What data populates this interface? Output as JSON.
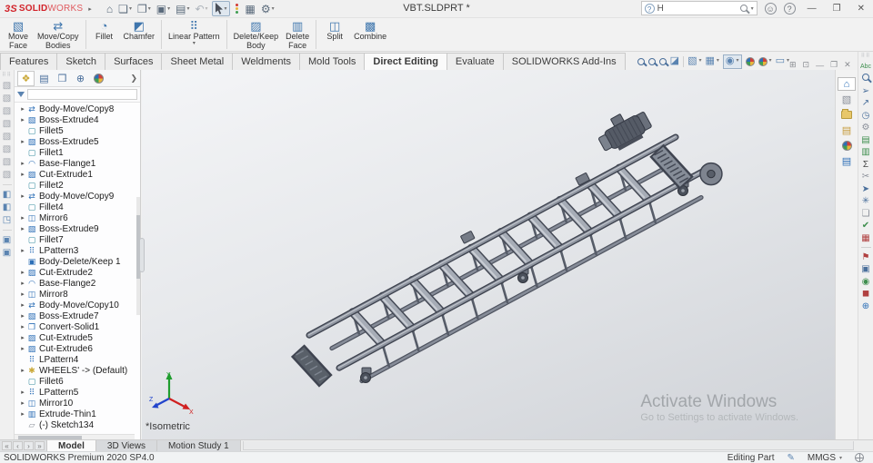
{
  "window": {
    "brand_prefix": "3S",
    "brand": "SOLID",
    "brand_suffix": "WORKS",
    "title": "VBT.SLDPRT *",
    "search_value": "H",
    "controls": {
      "minimize": "—",
      "restore": "❐",
      "close": "✕"
    }
  },
  "quick_access": [
    {
      "name": "home-button",
      "glyph": "⌂",
      "dropdown": false
    },
    {
      "name": "new-document-button",
      "glyph": "❏",
      "dropdown": true
    },
    {
      "name": "open-button",
      "glyph": "❐",
      "dropdown": true
    },
    {
      "name": "save-button",
      "glyph": "▣",
      "dropdown": true
    },
    {
      "name": "print-button",
      "glyph": "▤",
      "dropdown": true
    },
    {
      "name": "undo-button",
      "glyph": "↶",
      "dropdown": true,
      "disabled": true
    },
    {
      "name": "select-button",
      "glyph": "cursor",
      "dropdown": true,
      "selected": true
    },
    {
      "name": "rebuild-button",
      "glyph": "traffic",
      "dropdown": false
    },
    {
      "name": "file-properties-button",
      "glyph": "▦",
      "dropdown": false
    },
    {
      "name": "options-button",
      "glyph": "⚙",
      "dropdown": true
    }
  ],
  "ribbon": {
    "groups": [
      {
        "buttons": [
          {
            "label": "Move\nFace",
            "icon": "▧",
            "name": "move-face-button"
          },
          {
            "label": "Move/Copy\nBodies",
            "icon": "⇄",
            "name": "move-copy-bodies-button"
          }
        ]
      },
      {
        "buttons": [
          {
            "label": "Fillet",
            "icon": "◔",
            "name": "fillet-button"
          },
          {
            "label": "Chamfer",
            "icon": "◩",
            "name": "chamfer-button"
          }
        ]
      },
      {
        "buttons": [
          {
            "label": "Linear Pattern",
            "icon": "⠿",
            "name": "linear-pattern-button",
            "dropdown": true
          }
        ]
      },
      {
        "buttons": [
          {
            "label": "Delete/Keep\nBody",
            "icon": "▨",
            "name": "delete-keep-body-button"
          },
          {
            "label": "Delete\nFace",
            "icon": "▥",
            "name": "delete-face-button"
          }
        ]
      },
      {
        "buttons": [
          {
            "label": "Split",
            "icon": "◫",
            "name": "split-button"
          },
          {
            "label": "Combine",
            "icon": "▩",
            "name": "combine-button"
          }
        ]
      }
    ]
  },
  "command_tabs": {
    "items": [
      "Features",
      "Sketch",
      "Surfaces",
      "Sheet Metal",
      "Weldments",
      "Mold Tools",
      "Direct Editing",
      "Evaluate",
      "SOLIDWORKS Add-Ins"
    ],
    "active": "Direct Editing"
  },
  "headsup_toolbar": [
    {
      "name": "zoom-to-fit-icon",
      "type": "mag"
    },
    {
      "name": "zoom-to-area-icon",
      "type": "mag"
    },
    {
      "name": "previous-view-icon",
      "type": "mag"
    },
    {
      "name": "section-view-icon",
      "glyph": "◪"
    },
    {
      "name": "sep"
    },
    {
      "name": "view-orientation-icon",
      "glyph": "▧",
      "dropdown": true
    },
    {
      "name": "display-style-icon",
      "glyph": "▦",
      "dropdown": true
    },
    {
      "name": "hide-show-items-icon",
      "glyph": "◉",
      "dropdown": true,
      "boxed": true
    },
    {
      "name": "edit-appearance-icon",
      "type": "pie"
    },
    {
      "name": "apply-scene-icon",
      "type": "pie",
      "dropdown": true
    },
    {
      "name": "view-settings-icon",
      "glyph": "▭",
      "dropdown": true
    }
  ],
  "doc_window_controls": [
    "⊞",
    "⊡",
    "—",
    "❐",
    "✕"
  ],
  "left_strip_icons": [
    "▧",
    "▧",
    "▧",
    "▧",
    "▧",
    "▧",
    "▧",
    "▧",
    "|",
    "◧",
    "◧",
    "◳",
    "|",
    "▣",
    "▣"
  ],
  "feature_panel": {
    "tabs": [
      {
        "name": "featuremanager-tab",
        "glyph": "❖",
        "color": "#caa93a",
        "active": true
      },
      {
        "name": "propertymanager-tab",
        "glyph": "▤",
        "color": "#4a6f9b"
      },
      {
        "name": "configurationmanager-tab",
        "glyph": "❒",
        "color": "#4a6f9b"
      },
      {
        "name": "dimxpertmanager-tab",
        "glyph": "⊕",
        "color": "#4a6f9b"
      },
      {
        "name": "displaymanager-tab",
        "type": "pie"
      }
    ],
    "expand_arrow": "❯",
    "tree_items": [
      {
        "label": "Body-Move/Copy8",
        "icon": "move",
        "arrow": true
      },
      {
        "label": "Boss-Extrude4",
        "icon": "extrude",
        "arrow": true
      },
      {
        "label": "Fillet5",
        "icon": "fillet",
        "arrow": false
      },
      {
        "label": "Boss-Extrude5",
        "icon": "extrude",
        "arrow": true
      },
      {
        "label": "Fillet1",
        "icon": "fillet",
        "arrow": false
      },
      {
        "label": "Base-Flange1",
        "icon": "flange",
        "arrow": true
      },
      {
        "label": "Cut-Extrude1",
        "icon": "cut",
        "arrow": true
      },
      {
        "label": "Fillet2",
        "icon": "fillet",
        "arrow": false
      },
      {
        "label": "Body-Move/Copy9",
        "icon": "move",
        "arrow": true
      },
      {
        "label": "Fillet4",
        "icon": "fillet",
        "arrow": false
      },
      {
        "label": "Mirror6",
        "icon": "mirror",
        "arrow": true
      },
      {
        "label": "Boss-Extrude9",
        "icon": "extrude",
        "arrow": true
      },
      {
        "label": "Fillet7",
        "icon": "fillet",
        "arrow": false
      },
      {
        "label": "LPattern3",
        "icon": "pattern",
        "arrow": true
      },
      {
        "label": "Body-Delete/Keep 1",
        "icon": "deletekeep",
        "arrow": false
      },
      {
        "label": "Cut-Extrude2",
        "icon": "cut",
        "arrow": true
      },
      {
        "label": "Base-Flange2",
        "icon": "flange",
        "arrow": true
      },
      {
        "label": "Mirror8",
        "icon": "mirror",
        "arrow": true
      },
      {
        "label": "Body-Move/Copy10",
        "icon": "move",
        "arrow": true
      },
      {
        "label": "Boss-Extrude7",
        "icon": "extrude",
        "arrow": true
      },
      {
        "label": "Convert-Solid1",
        "icon": "convert",
        "arrow": true
      },
      {
        "label": "Cut-Extrude5",
        "icon": "cut",
        "arrow": true
      },
      {
        "label": "Cut-Extrude6",
        "icon": "cut",
        "arrow": true
      },
      {
        "label": "LPattern4",
        "icon": "pattern",
        "arrow": false
      },
      {
        "label": "WHEELS' -> (Default)",
        "icon": "wheels",
        "arrow": true
      },
      {
        "label": "Fillet6",
        "icon": "fillet",
        "arrow": false
      },
      {
        "label": "LPattern5",
        "icon": "pattern",
        "arrow": true
      },
      {
        "label": "Mirror10",
        "icon": "mirror",
        "arrow": true
      },
      {
        "label": "Extrude-Thin1",
        "icon": "thin",
        "arrow": true
      },
      {
        "label": "(-) Sketch134",
        "icon": "sketch",
        "arrow": false
      }
    ]
  },
  "viewport": {
    "view_label": "*Isometric",
    "watermark_line1": "Activate Windows",
    "watermark_line2": "Go to Settings to activate Windows.",
    "triad": {
      "x": "X",
      "y": "Y",
      "z": "Z"
    },
    "model_name": "conveyor-frame"
  },
  "task_pane_tabs": [
    {
      "name": "home-tab",
      "glyph": "⌂",
      "color": "#2d6fb7",
      "active": true
    },
    {
      "name": "solidworks-resources-tab",
      "glyph": "▧",
      "color": "#8a8f99"
    },
    {
      "name": "design-library-tab",
      "type": "folder"
    },
    {
      "name": "view-palette-tab",
      "glyph": "▤",
      "color": "#c59a3a"
    },
    {
      "name": "appearances-scenes-tab",
      "type": "pie"
    },
    {
      "name": "custom-properties-tab",
      "glyph": "▤",
      "color": "#2d6fb7"
    }
  ],
  "right_tools": [
    {
      "name": "spell-checker-icon",
      "glyph": "Abc",
      "color": "#3f8f4f",
      "text": true
    },
    {
      "name": "design-checker-icon",
      "type": "mag"
    },
    {
      "name": "measure-icon",
      "glyph": "➢",
      "color": "#4a6f9b"
    },
    {
      "name": "sustainability-icon",
      "glyph": "↗",
      "color": "#4a6f9b"
    },
    {
      "name": "performance-evaluation-icon",
      "glyph": "◷",
      "color": "#4a6f9b"
    },
    {
      "name": "simulation-icon",
      "glyph": "⚙",
      "color": "#8a8f99"
    },
    {
      "name": "compare-documents-icon",
      "glyph": "▤",
      "color": "#3f8f4f"
    },
    {
      "name": "check-active-document-icon",
      "glyph": "▥",
      "color": "#3f8f4f"
    },
    {
      "name": "equations-icon",
      "glyph": "Σ",
      "color": "#444444"
    },
    {
      "name": "tools-icon",
      "glyph": "✂",
      "color": "#8a8f99"
    },
    {
      "name": "route-icon",
      "glyph": "➤",
      "color": "#4a6f9b"
    },
    {
      "name": "costing-icon",
      "glyph": "✳",
      "color": "#4a6f9b"
    },
    {
      "name": "pages-icon",
      "glyph": "❏",
      "color": "#8a8f99"
    },
    {
      "name": "curvature-check-icon",
      "glyph": "✔",
      "color": "#3f8f4f"
    },
    {
      "name": "delete-table-icon",
      "glyph": "▦",
      "color": "#b04040"
    },
    {
      "name": "divider"
    },
    {
      "name": "collage-icon",
      "glyph": "⚑",
      "color": "#b04040"
    },
    {
      "name": "image-icon",
      "glyph": "▣",
      "color": "#4a6f9b"
    },
    {
      "name": "accept-icon",
      "glyph": "◉",
      "color": "#3f8f4f"
    },
    {
      "name": "blocks-icon",
      "glyph": "◼",
      "color": "#b04040"
    },
    {
      "name": "update-icon",
      "glyph": "⊕",
      "color": "#2d6fb7"
    }
  ],
  "bottom_tabs": {
    "nav": [
      "«",
      "‹",
      "›",
      "»"
    ],
    "items": [
      "Model",
      "3D Views",
      "Motion Study 1"
    ],
    "active": "Model"
  },
  "status_bar": {
    "left": "SOLIDWORKS Premium 2020 SP4.0",
    "mode": "Editing Part",
    "units": "MMGS",
    "units_caret": "▾"
  },
  "colors": {
    "accent_blue": "#2d6fb7",
    "brand_red": "#d2232a",
    "frame_dark": "#3f4450",
    "frame_mid": "#8f95a0",
    "roller_light": "#aab0ba",
    "viewport_top": "#f4f5f7",
    "viewport_bottom": "#cfd2d7"
  }
}
